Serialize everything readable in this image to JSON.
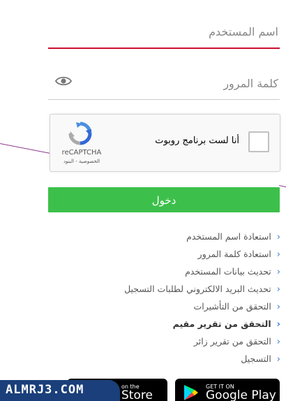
{
  "form": {
    "username_placeholder": "اسم المستخدم",
    "password_placeholder": "كلمة المرور",
    "login_label": "دخول"
  },
  "captcha": {
    "label": "أنا لست برنامج روبوت",
    "brand": "reCAPTCHA",
    "terms": "الخصوصية - البنود"
  },
  "links": [
    {
      "label": "استعادة اسم المستخدم"
    },
    {
      "label": "استعادة كلمة المرور"
    },
    {
      "label": "تحديث بيانات المستخدم"
    },
    {
      "label": "تحديث البريد الالكتروني لطلبات التسجيل"
    },
    {
      "label": "التحقق من التأشيرات"
    },
    {
      "label": "التحقق من تقرير مقيم"
    },
    {
      "label": "التحقق من تقرير زائر"
    },
    {
      "label": "التسجيل"
    }
  ],
  "stores": {
    "play_small": "GET IT ON",
    "play_big": "Google Play",
    "appstore_small": "on the",
    "appstore_big": "Store"
  },
  "watermark": "ALMRJ3.COM",
  "colors": {
    "accent_red": "#c8102e",
    "login_green": "#3dc04b",
    "link_chevron": "#3a7bd5"
  },
  "icons": [
    "eye-icon",
    "recaptcha-logo",
    "chevron-left-icon",
    "google-play-icon"
  ]
}
